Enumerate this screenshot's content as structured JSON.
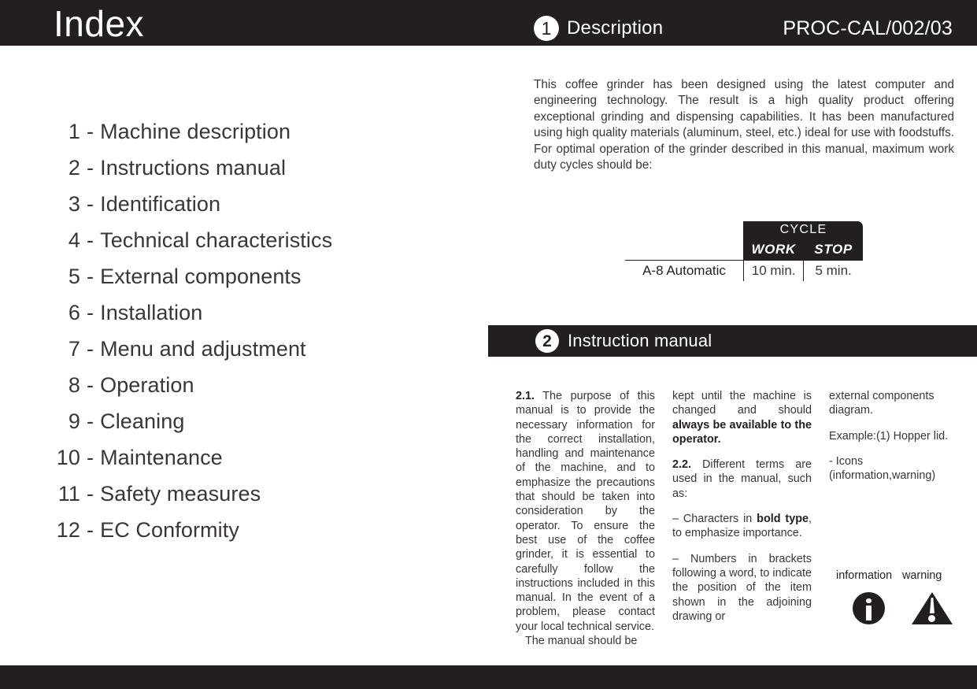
{
  "header": {
    "page_title": "Index",
    "chapter_number": "1",
    "chapter_name": "Description",
    "doc_code": "PROC-CAL/002/03"
  },
  "index": {
    "items": [
      {
        "num": "1",
        "dash": "-",
        "label": "Machine description"
      },
      {
        "num": "2",
        "dash": "-",
        "label": "Instructions manual"
      },
      {
        "num": "3",
        "dash": "-",
        "label": "Identification"
      },
      {
        "num": "4",
        "dash": "-",
        "label": "Technical characteristics"
      },
      {
        "num": "5",
        "dash": "-",
        "label": "External components"
      },
      {
        "num": "6",
        "dash": "-",
        "label": "Installation"
      },
      {
        "num": "7",
        "dash": "-",
        "label": "Menu and adjustment"
      },
      {
        "num": "8",
        "dash": "-",
        "label": "Operation"
      },
      {
        "num": "9",
        "dash": "-",
        "label": "Cleaning"
      },
      {
        "num": "10",
        "dash": "-",
        "label": "Maintenance"
      },
      {
        "num": "11",
        "dash": "-",
        "label": "Safety measures"
      },
      {
        "num": "12",
        "dash": "-",
        "label": "EC Conformity"
      }
    ]
  },
  "description": {
    "paragraph": "This coffee grinder has been designed using the latest computer and engineering technology. The result is a high quality product offering exceptional grinding and dispensing capabilities. It has been manufactured using high quality materials (aluminum, steel, etc.) ideal for use with foodstuffs. For optimal operation of the grinder described in this manual, maximum work duty cycles should be:"
  },
  "cycle_table": {
    "group_header": "CYCLE",
    "sub_headers": [
      "WORK",
      "STOP"
    ],
    "rows": [
      {
        "model": "A-8 Automatic",
        "work": "10 min.",
        "stop": "5 min."
      }
    ]
  },
  "section2": {
    "number": "2",
    "title": "Instruction manual"
  },
  "body": {
    "col1": {
      "p1_label": "2.1.",
      "p1_text": " The purpose of this manual is to provide the necessary information for the correct installation, handling and maintenance of the machine, and to emphasize the precautions that should be taken into consideration by the operator. To ensure the best use of the coffee grinder, it is essential to carefully follow the instructions included in this manual. In the event of a problem, please contact your local technical service.",
      "p2_text": "The manual should be"
    },
    "col2": {
      "p1_pre": "kept until the machine is changed and should ",
      "p1_bold": "always be available to the operator.",
      "p2_label": "2.2.",
      "p2_text": " Different terms are used in the manual, such as:",
      "p3_pre": "– Characters in ",
      "p3_bold": "bold type",
      "p3_post": ", to emphasize importance.",
      "p4_text": "– Numbers in brackets following a word, to indicate the position of the item shown in the adjoining drawing or"
    },
    "col3": {
      "p1_text": "external components diagram.",
      "p2_text": "Example:(1)  Hopper lid.",
      "p3_text": "- Icons",
      "p4_text": "(information,warning)",
      "legend_information": "information",
      "legend_warning": "warning"
    }
  },
  "colors": {
    "dark": "#231f20",
    "body_text": "#3a3637",
    "page_background": "#ffffff"
  }
}
